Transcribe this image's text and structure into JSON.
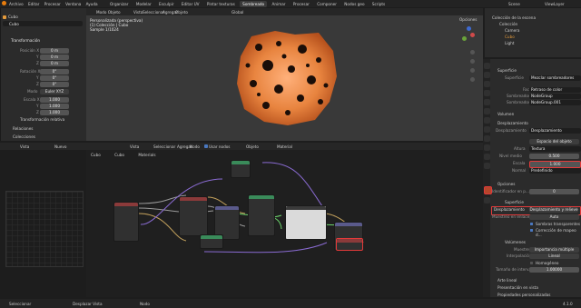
{
  "menu": [
    "Archivo",
    "Editar",
    "Procesar",
    "Ventana",
    "Ayuda"
  ],
  "workspaces": [
    "Organizar",
    "Modelar",
    "Esculpir",
    "Editar UV",
    "Pintar texturas",
    "Sombreado",
    "Animar",
    "Procesar",
    "Componer",
    "Nodos geo",
    "Scripts"
  ],
  "active_workspace": "Sombreado",
  "scene_name": "Scene",
  "view_layer": "ViewLayer",
  "sidebar": {
    "object_name": "Cubo",
    "section_transform": "Transformación",
    "position_label": "Posición X",
    "pos": [
      "0 m",
      "0 m",
      "0 m"
    ],
    "rotation_label": "Rotación X",
    "rot": [
      "0°",
      "0°",
      "0°"
    ],
    "mode_label": "Modo",
    "mode_value": "Euler XYZ",
    "scale_label": "Escala X",
    "scale": [
      "1.000",
      "1.000",
      "1.000"
    ],
    "axis_y": "Y",
    "axis_z": "Z",
    "delta": "Transformación relativa",
    "relations": "Relaciones",
    "collections": "Colecciones"
  },
  "viewport": {
    "mode": "Modo Objeto",
    "menus": [
      "Vista",
      "Seleccionar",
      "Agregar",
      "Objeto"
    ],
    "shading": "Global",
    "info1": "Personalizada (perspectiva)",
    "info2": "(1) Colección | Cubo",
    "info3": "Sample 1/1024",
    "options": "Opciones"
  },
  "node_editor": {
    "menus": [
      "Vista",
      "Seleccionar",
      "Agregar",
      "Nodo"
    ],
    "use_nodes": "Usar nodos",
    "slot": "Objeto",
    "new": "Nuevo",
    "material": "Material",
    "breadcrumb": [
      "Cubo",
      "Cubo",
      "Materials"
    ]
  },
  "outliner": {
    "title": "Colección de la escena",
    "items": [
      "Colección",
      "Camera",
      "Cubo",
      "Light"
    ]
  },
  "properties": {
    "surface": "Superficie",
    "surface_value": "Mezclar sombreadores",
    "fac_label": "Fac",
    "fac_value": "Retraso de color",
    "shader1_label": "Sombreador",
    "shader1_value": "NodeGroup",
    "shader2_label": "Sombreador",
    "shader2_value": "NodeGroup.001",
    "volume": "Volumen",
    "displacement_section": "Desplazamiento",
    "displacement_label": "Desplazamiento",
    "displacement_value": "Desplazamiento",
    "space_value": "Espacio del objeto",
    "height_label": "Altura",
    "height_value": "Textura",
    "midlevel_label": "Nivel medio",
    "midlevel_value": "0.500",
    "scale_label": "Escala",
    "scale_value": "1.000",
    "normal_label": "Normal",
    "normal_value": "Predefinido",
    "options": "Opciones",
    "pass_index_label": "Identificador en p...",
    "pass_index_value": "0",
    "surface2": "Superficie",
    "disp_method_label": "Desplazamiento",
    "disp_method_value": "Desplazamiento y relieve",
    "mask_label": "Muestreo en enlace",
    "mask_value": "Auto",
    "transparent": "Sombras transparentes",
    "bump_fix": "Corrección de mapeo d...",
    "volumes": "Volúmenes",
    "sampling_label": "Muestreo",
    "sampling_value": "Importancia múltiple",
    "interp_label": "Interpolación",
    "interp_value": "Lineal",
    "homogeneous": "Homogéneo",
    "step_label": "Tamaño de interv...",
    "step_value": "1.00000",
    "line_art": "Arte lineal",
    "viewport_display": "Presentación en vista",
    "custom_props": "Propiedades personalizadas"
  },
  "status": {
    "select": "Seleccionar",
    "pan": "Desplazar Vista",
    "node": "Nodo",
    "version": "4.1.0"
  }
}
